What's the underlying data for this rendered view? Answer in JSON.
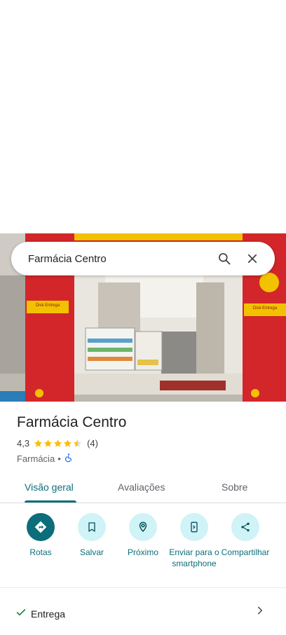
{
  "search": {
    "query": "Farmácia Centro"
  },
  "place": {
    "name": "Farmácia Centro",
    "rating": "4,3",
    "rating_value": 4.3,
    "review_count": "(4)",
    "category": "Farmácia",
    "separator": "•"
  },
  "photo_signs": {
    "left": "Disk Entrega",
    "right": "Disk Entrega"
  },
  "tabs": [
    {
      "label": "Visão geral",
      "active": true
    },
    {
      "label": "Avaliações",
      "active": false
    },
    {
      "label": "Sobre",
      "active": false
    }
  ],
  "actions": [
    {
      "label": "Rotas",
      "icon": "directions-icon"
    },
    {
      "label": "Salvar",
      "icon": "bookmark-icon"
    },
    {
      "label": "Próximo",
      "icon": "nearby-icon"
    },
    {
      "label": "Enviar para o smartphone",
      "icon": "send-to-phone-icon"
    },
    {
      "label": "Compartilhar",
      "icon": "share-icon"
    }
  ],
  "delivery": {
    "label": "Entrega"
  },
  "colors": {
    "accent": "#0b6e7a",
    "accent_light": "#cff3f7",
    "star": "#fbbc04",
    "check": "#188038"
  }
}
